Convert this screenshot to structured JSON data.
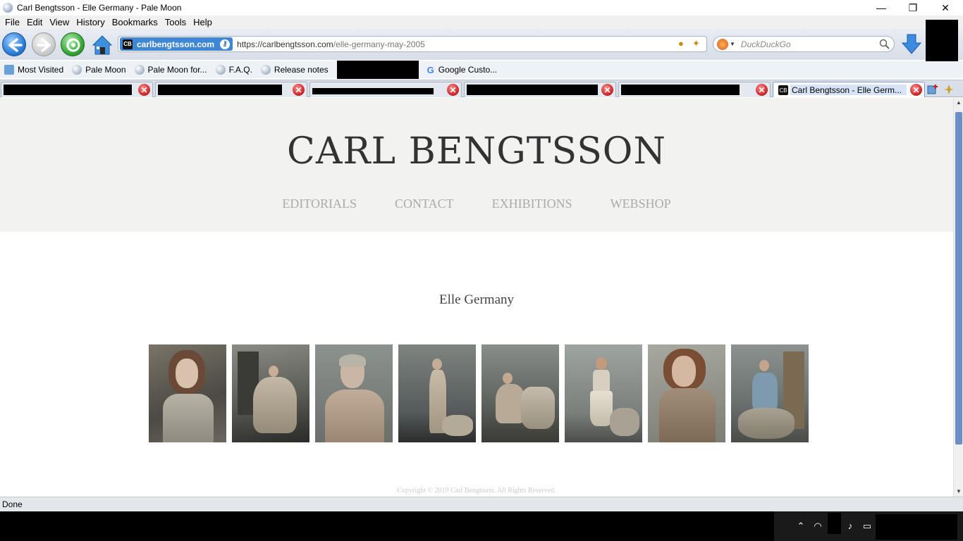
{
  "window": {
    "title": "Carl Bengtsson - Elle Germany - Pale Moon",
    "minimize": "—",
    "restore": "❐",
    "close": "✕"
  },
  "menu": [
    {
      "label": "File",
      "key": "F"
    },
    {
      "label": "Edit",
      "key": "E"
    },
    {
      "label": "View",
      "key": "V"
    },
    {
      "label": "History",
      "key": "s"
    },
    {
      "label": "Bookmarks",
      "key": "B"
    },
    {
      "label": "Tools",
      "key": "T"
    },
    {
      "label": "Help",
      "key": "H"
    }
  ],
  "urlbar": {
    "identity": "carlbengtsson.com",
    "fav": "CB",
    "url_host": "https://carlbengtsson.com",
    "url_path": "/elle-germany-may-2005"
  },
  "search": {
    "placeholder": "DuckDuckGo"
  },
  "bookmarks": [
    {
      "label": "Most Visited",
      "icon": "most-visited-icon"
    },
    {
      "label": "Pale Moon",
      "icon": "globe-icon"
    },
    {
      "label": "Pale Moon for...",
      "icon": "globe-icon"
    },
    {
      "label": "F.A.Q.",
      "icon": "globe-icon"
    },
    {
      "label": "Release notes",
      "icon": "globe-icon"
    },
    {
      "label": "Google Custo...",
      "icon": "google-icon"
    }
  ],
  "tabs": {
    "active_label": "Carl Bengtsson - Elle Germ..."
  },
  "site": {
    "title": "CARL BENGTSSON",
    "nav": [
      "EDITORIALS",
      "CONTACT",
      "EXHIBITIONS",
      "WEBSHOP"
    ],
    "heading": "Elle Germany",
    "gallery_count": 8,
    "copyright": "Copyright © 2019 Carl Bengtsson. All Rights Reserved."
  },
  "status": {
    "text": "Done"
  },
  "colors": {
    "header_bg": "#f2f2f0",
    "nav_text": "#aaaaaa",
    "title_text": "#333333",
    "accent": "#3f86d4"
  }
}
